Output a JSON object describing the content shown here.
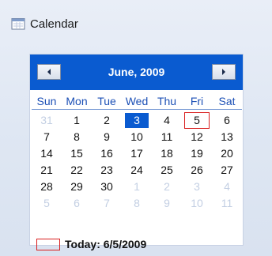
{
  "heading": {
    "label": "Calendar",
    "icon": "calendar-icon"
  },
  "calendar": {
    "month_title": "June, 2009",
    "prev_icon": "chevron-left-icon",
    "next_icon": "chevron-right-icon",
    "days_of_week": [
      "Sun",
      "Mon",
      "Tue",
      "Wed",
      "Thu",
      "Fri",
      "Sat"
    ],
    "weeks": [
      [
        {
          "d": "31",
          "other": true
        },
        {
          "d": "1"
        },
        {
          "d": "2"
        },
        {
          "d": "3",
          "selected": true
        },
        {
          "d": "4"
        },
        {
          "d": "5",
          "today": true
        },
        {
          "d": "6"
        }
      ],
      [
        {
          "d": "7"
        },
        {
          "d": "8"
        },
        {
          "d": "9"
        },
        {
          "d": "10"
        },
        {
          "d": "11"
        },
        {
          "d": "12"
        },
        {
          "d": "13"
        }
      ],
      [
        {
          "d": "14"
        },
        {
          "d": "15"
        },
        {
          "d": "16"
        },
        {
          "d": "17"
        },
        {
          "d": "18"
        },
        {
          "d": "19"
        },
        {
          "d": "20"
        }
      ],
      [
        {
          "d": "21"
        },
        {
          "d": "22"
        },
        {
          "d": "23"
        },
        {
          "d": "24"
        },
        {
          "d": "25"
        },
        {
          "d": "26"
        },
        {
          "d": "27"
        }
      ],
      [
        {
          "d": "28"
        },
        {
          "d": "29"
        },
        {
          "d": "30"
        },
        {
          "d": "1",
          "other": true
        },
        {
          "d": "2",
          "other": true
        },
        {
          "d": "3",
          "other": true
        },
        {
          "d": "4",
          "other": true
        }
      ],
      [
        {
          "d": "5",
          "other": true
        },
        {
          "d": "6",
          "other": true
        },
        {
          "d": "7",
          "other": true
        },
        {
          "d": "8",
          "other": true
        },
        {
          "d": "9",
          "other": true
        },
        {
          "d": "10",
          "other": true
        },
        {
          "d": "11",
          "other": true
        }
      ]
    ],
    "today_label": "Today: 6/5/2009"
  },
  "colors": {
    "header_bg": "#0a5bd0",
    "selected_bg": "#0a5bd0",
    "today_border": "#d91e1e",
    "day_of_week_text": "#1b4fb5",
    "other_month_text": "#c3cfe3"
  }
}
